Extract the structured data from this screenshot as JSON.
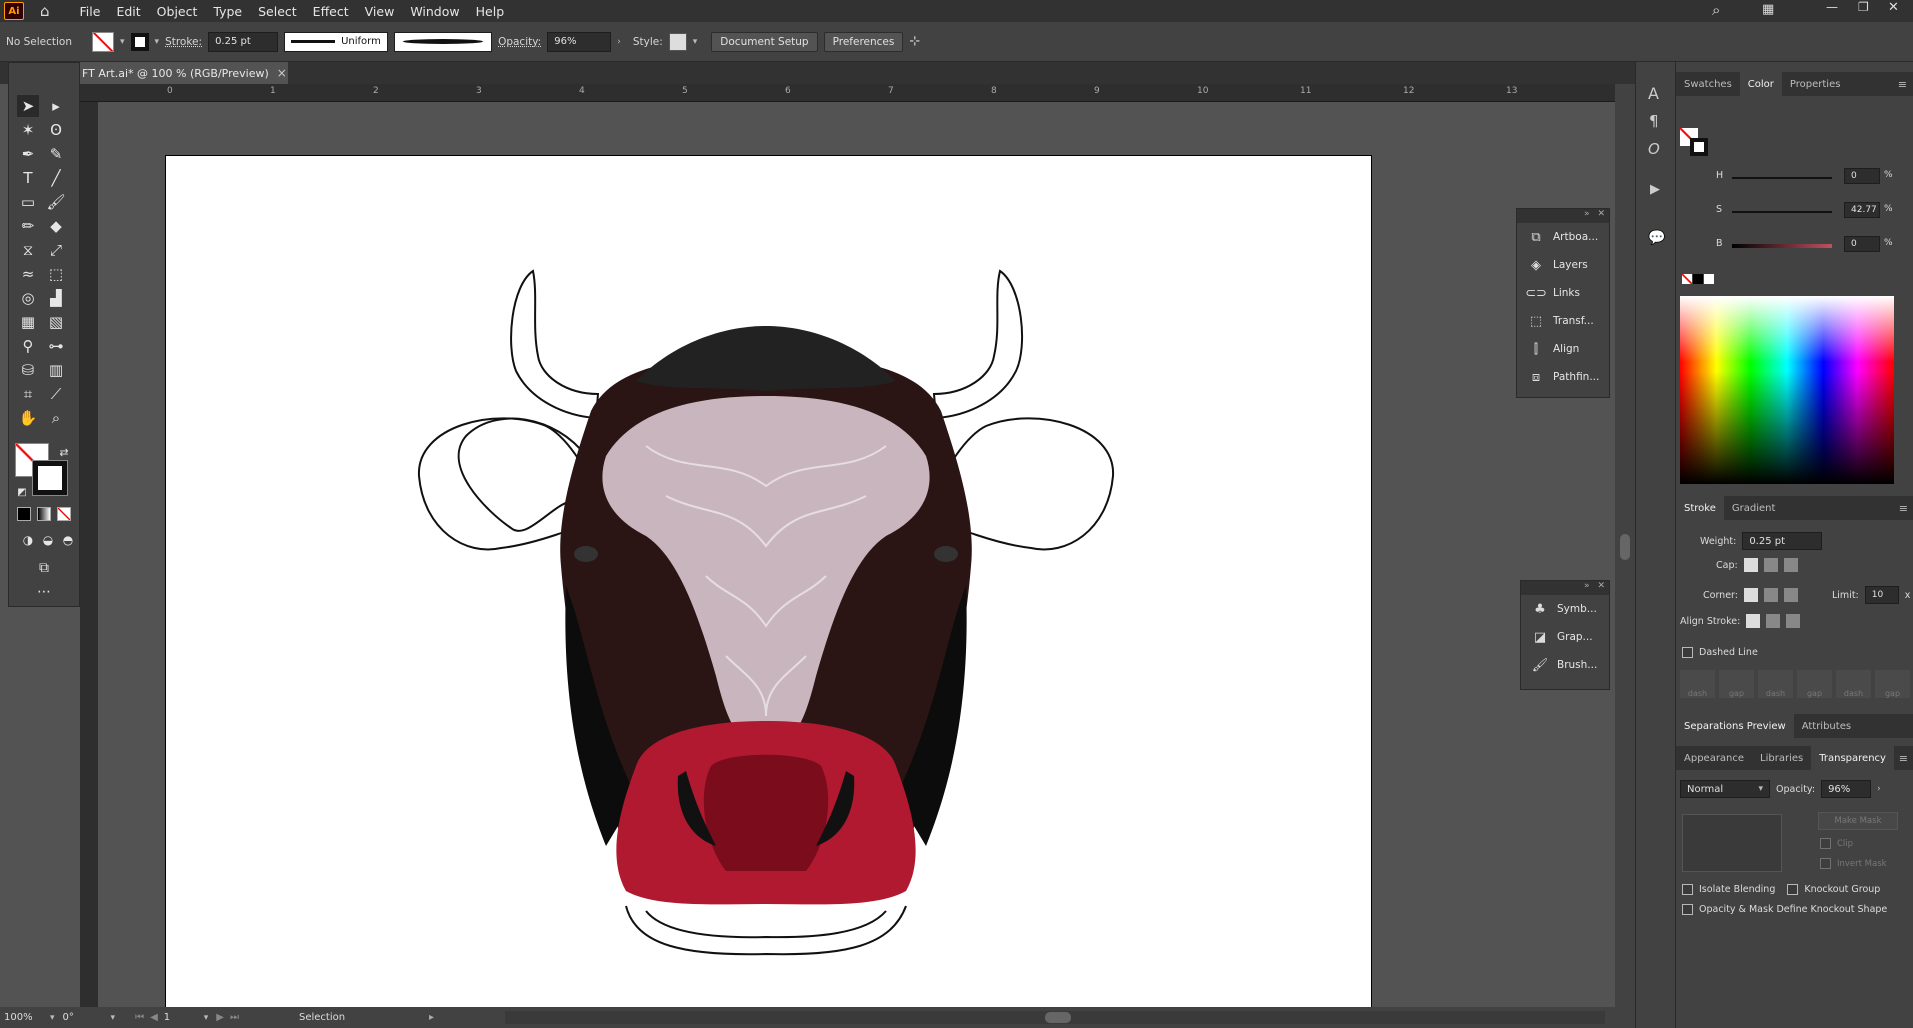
{
  "app": {
    "logo": "Ai"
  },
  "menu": [
    "File",
    "Edit",
    "Object",
    "Type",
    "Select",
    "Effect",
    "View",
    "Window",
    "Help"
  ],
  "control": {
    "selection": "No Selection",
    "stroke_label": "Stroke:",
    "stroke_value": "0.25 pt",
    "profile": "Uniform",
    "opacity_label": "Opacity:",
    "opacity_value": "96%",
    "style_label": "Style:",
    "doc_setup": "Document Setup",
    "preferences": "Preferences"
  },
  "doc_tab": {
    "title": "FT Art.ai* @ 100 % (RGB/Preview)",
    "close": "×"
  },
  "ruler": [
    "0",
    "1",
    "2",
    "3",
    "4",
    "5",
    "6",
    "7",
    "8",
    "9",
    "10",
    "11",
    "12",
    "13"
  ],
  "status": {
    "zoom": "100%",
    "rotate": "0°",
    "artboard": "1",
    "tool": "Selection"
  },
  "float_panel_1": [
    "Artboa...",
    "Layers",
    "Links",
    "Transf...",
    "Align",
    "Pathfin..."
  ],
  "float_panel_2": [
    "Symb...",
    "Grap...",
    "Brush..."
  ],
  "color_panel": {
    "tabs": [
      "Swatches",
      "Color",
      "Properties"
    ],
    "h_label": "H",
    "h_value": "0",
    "s_label": "S",
    "s_value": "42.77",
    "b_label": "B",
    "b_value": "0",
    "pct": "%"
  },
  "stroke_panel": {
    "tabs": [
      "Stroke",
      "Gradient"
    ],
    "weight_label": "Weight:",
    "weight_value": "0.25 pt",
    "cap_label": "Cap:",
    "corner_label": "Corner:",
    "limit_label": "Limit:",
    "limit_value": "10",
    "limit_unit": "x",
    "align_label": "Align Stroke:",
    "dashed": "Dashed Line",
    "dash_labels": [
      "dash",
      "gap",
      "dash",
      "gap",
      "dash",
      "gap"
    ]
  },
  "sep_tabs": [
    "Separations Preview",
    "Attributes"
  ],
  "transparency": {
    "tabs": [
      "Appearance",
      "Libraries",
      "Transparency"
    ],
    "mode": "Normal",
    "opacity_label": "Opacity:",
    "opacity_value": "96%",
    "make_mask": "Make Mask",
    "clip": "Clip",
    "invert": "Invert Mask",
    "isolate": "Isolate Blending",
    "knockout": "Knockout Group",
    "opacity_mask": "Opacity & Mask Define Knockout Shape"
  }
}
